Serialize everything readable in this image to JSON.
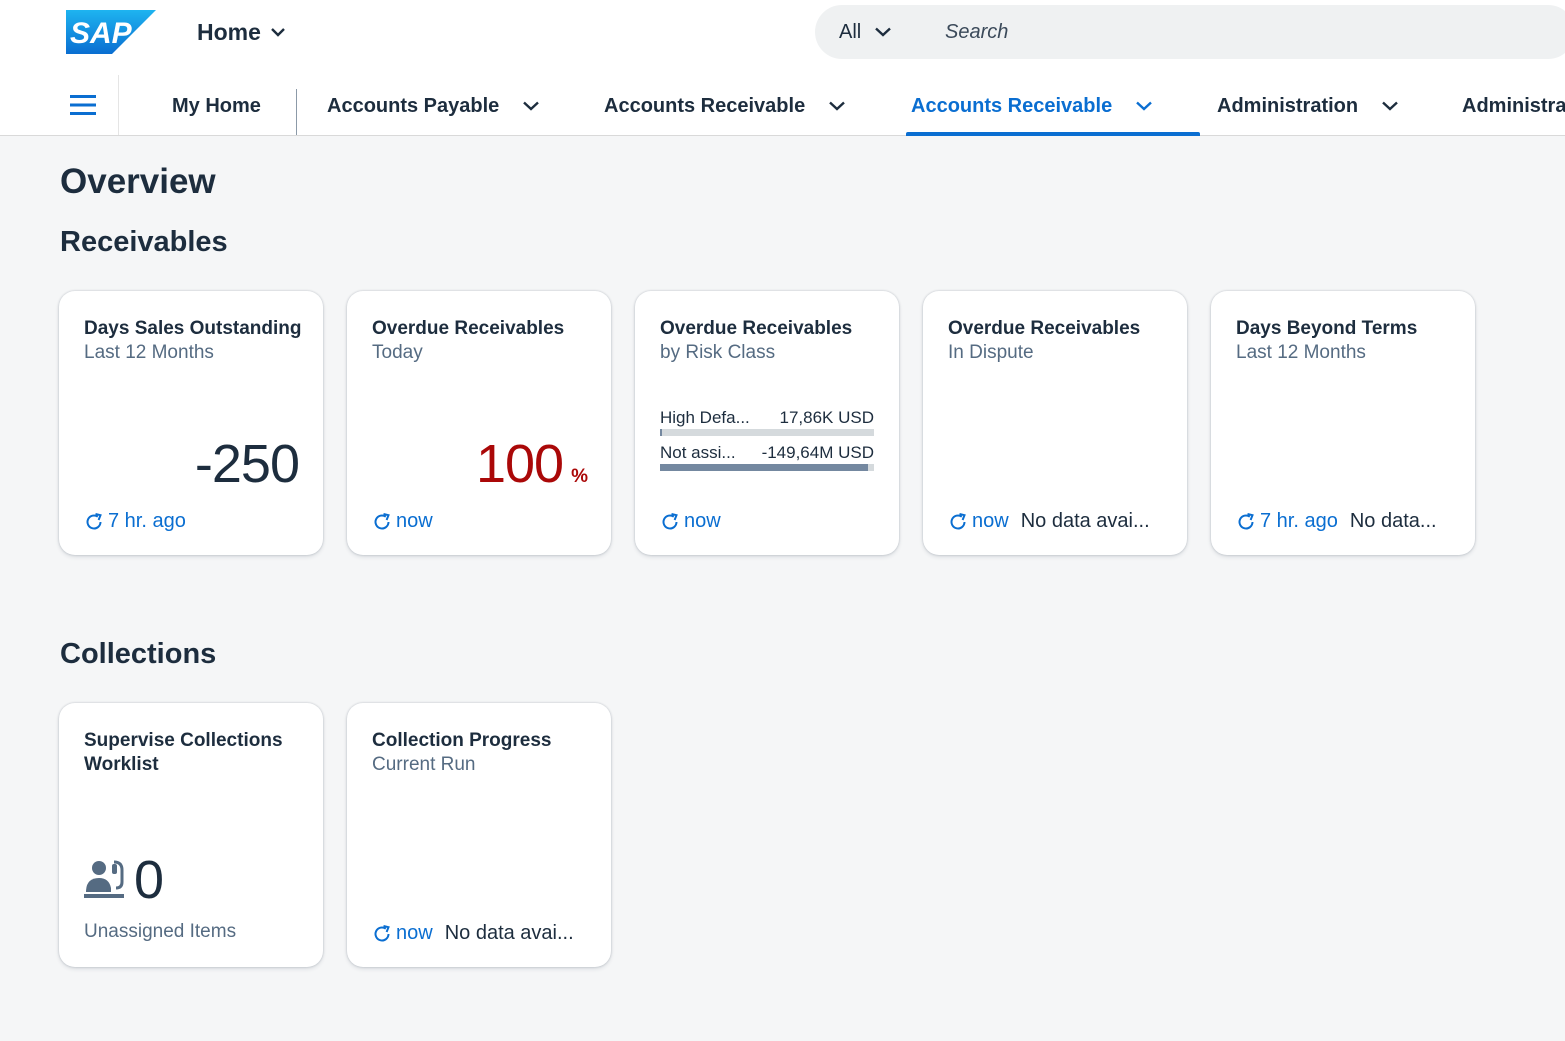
{
  "shell": {
    "logo_text": "SAP",
    "home_label": "Home",
    "search": {
      "scope": "All",
      "placeholder": "Search"
    }
  },
  "nav": {
    "tabs": [
      {
        "label": "My Home",
        "has_menu": false,
        "active": false
      },
      {
        "label": "Accounts Payable",
        "has_menu": true,
        "active": false
      },
      {
        "label": "Accounts Receivable",
        "has_menu": true,
        "active": false
      },
      {
        "label": "Accounts Receivable",
        "has_menu": true,
        "active": true
      },
      {
        "label": "Administration",
        "has_menu": true,
        "active": false
      },
      {
        "label": "Administra",
        "has_menu": false,
        "active": false
      }
    ]
  },
  "page": {
    "title": "Overview"
  },
  "sections": {
    "receivables": {
      "title": "Receivables",
      "tiles": [
        {
          "title": "Days Sales Outstanding",
          "subtitle": "Last 12 Months",
          "value": "-250",
          "refreshed": "7 hr. ago"
        },
        {
          "title": "Overdue Receivables",
          "subtitle": "Today",
          "value": "100",
          "unit": "%",
          "value_color": "#aa0808",
          "refreshed": "now"
        },
        {
          "title": "Overdue Receivables",
          "subtitle": "by Risk Class",
          "bars": [
            {
              "label": "High Defa...",
              "value": "17,86K USD",
              "fraction": 0.01
            },
            {
              "label": "Not assi...",
              "value": "-149,64M USD",
              "fraction": 0.97
            }
          ],
          "refreshed": "now"
        },
        {
          "title": "Overdue Receivables",
          "subtitle": "In Dispute",
          "refreshed": "now",
          "status": "No data avai..."
        },
        {
          "title": "Days Beyond Terms",
          "subtitle": "Last 12 Months",
          "refreshed": "7 hr. ago",
          "status": "No data..."
        }
      ]
    },
    "collections": {
      "title": "Collections",
      "tiles": [
        {
          "title": "Supervise Collections Worklist",
          "value": "0",
          "icon": "call-center-icon",
          "footnote": "Unassigned Items"
        },
        {
          "title": "Collection Progress",
          "subtitle": "Current Run",
          "refreshed": "now",
          "status": "No data avai..."
        }
      ]
    }
  },
  "colors": {
    "accent": "#0a6ed1",
    "critical": "#aa0808",
    "bar": "#7488a0"
  }
}
